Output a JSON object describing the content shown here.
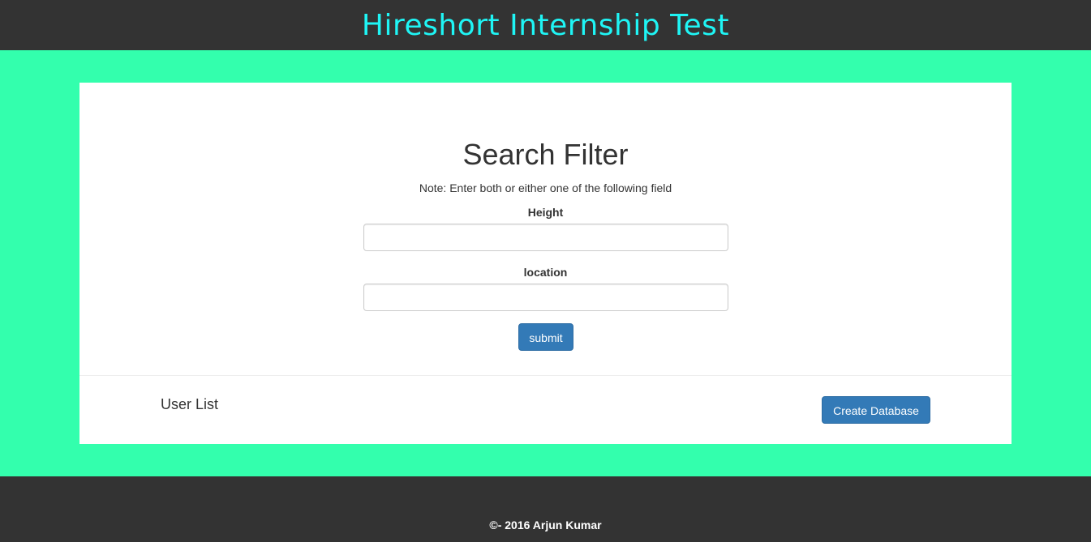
{
  "header": {
    "title": "Hireshort Internship Test"
  },
  "search": {
    "title": "Search Filter",
    "note": "Note: Enter both or either one of the following field",
    "height_label": "Height",
    "height_value": "",
    "location_label": "location",
    "location_value": "",
    "submit_label": "submit"
  },
  "users": {
    "list_label": "User List",
    "create_db_label": "Create Database"
  },
  "footer": {
    "copyright": "©- 2016 Arjun Kumar"
  },
  "colors": {
    "page_background": "#33ffad",
    "header_background": "#333333",
    "header_title": "#1ff5f5",
    "button_primary": "#337ab7",
    "footer_background": "#333333"
  }
}
